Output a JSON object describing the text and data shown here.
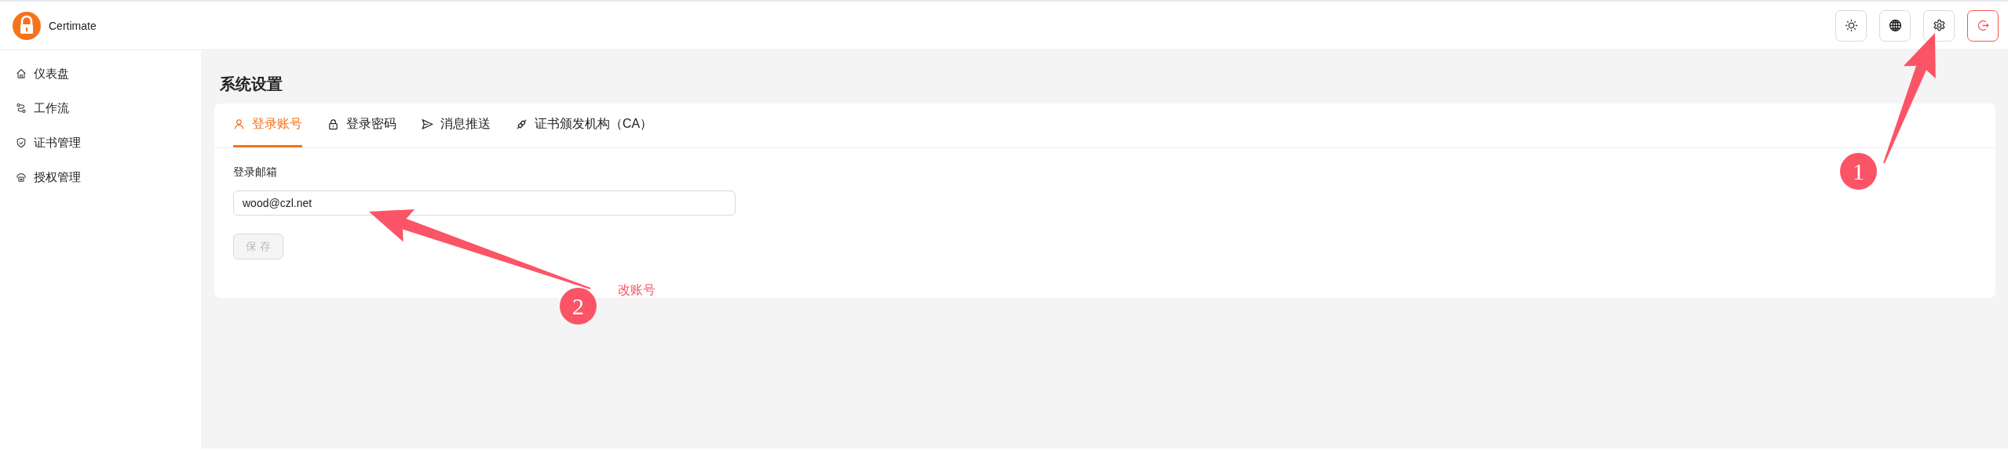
{
  "brand": {
    "name": "Certimate"
  },
  "sidebar": {
    "items": [
      {
        "label": "仪表盘"
      },
      {
        "label": "工作流"
      },
      {
        "label": "证书管理"
      },
      {
        "label": "授权管理"
      }
    ]
  },
  "page_title": "系统设置",
  "tabs": [
    {
      "label": "登录账号",
      "selected": true
    },
    {
      "label": "登录密码",
      "selected": false
    },
    {
      "label": "消息推送",
      "selected": false
    },
    {
      "label": "证书颁发机构（CA）",
      "selected": false
    }
  ],
  "form": {
    "label": "登录邮箱",
    "value": "wood@czl.net",
    "save_button": {
      "label": "保 存",
      "disabled": true
    }
  },
  "annotations": [
    {
      "number": "1"
    },
    {
      "number": "2",
      "note": "改账号"
    }
  ]
}
